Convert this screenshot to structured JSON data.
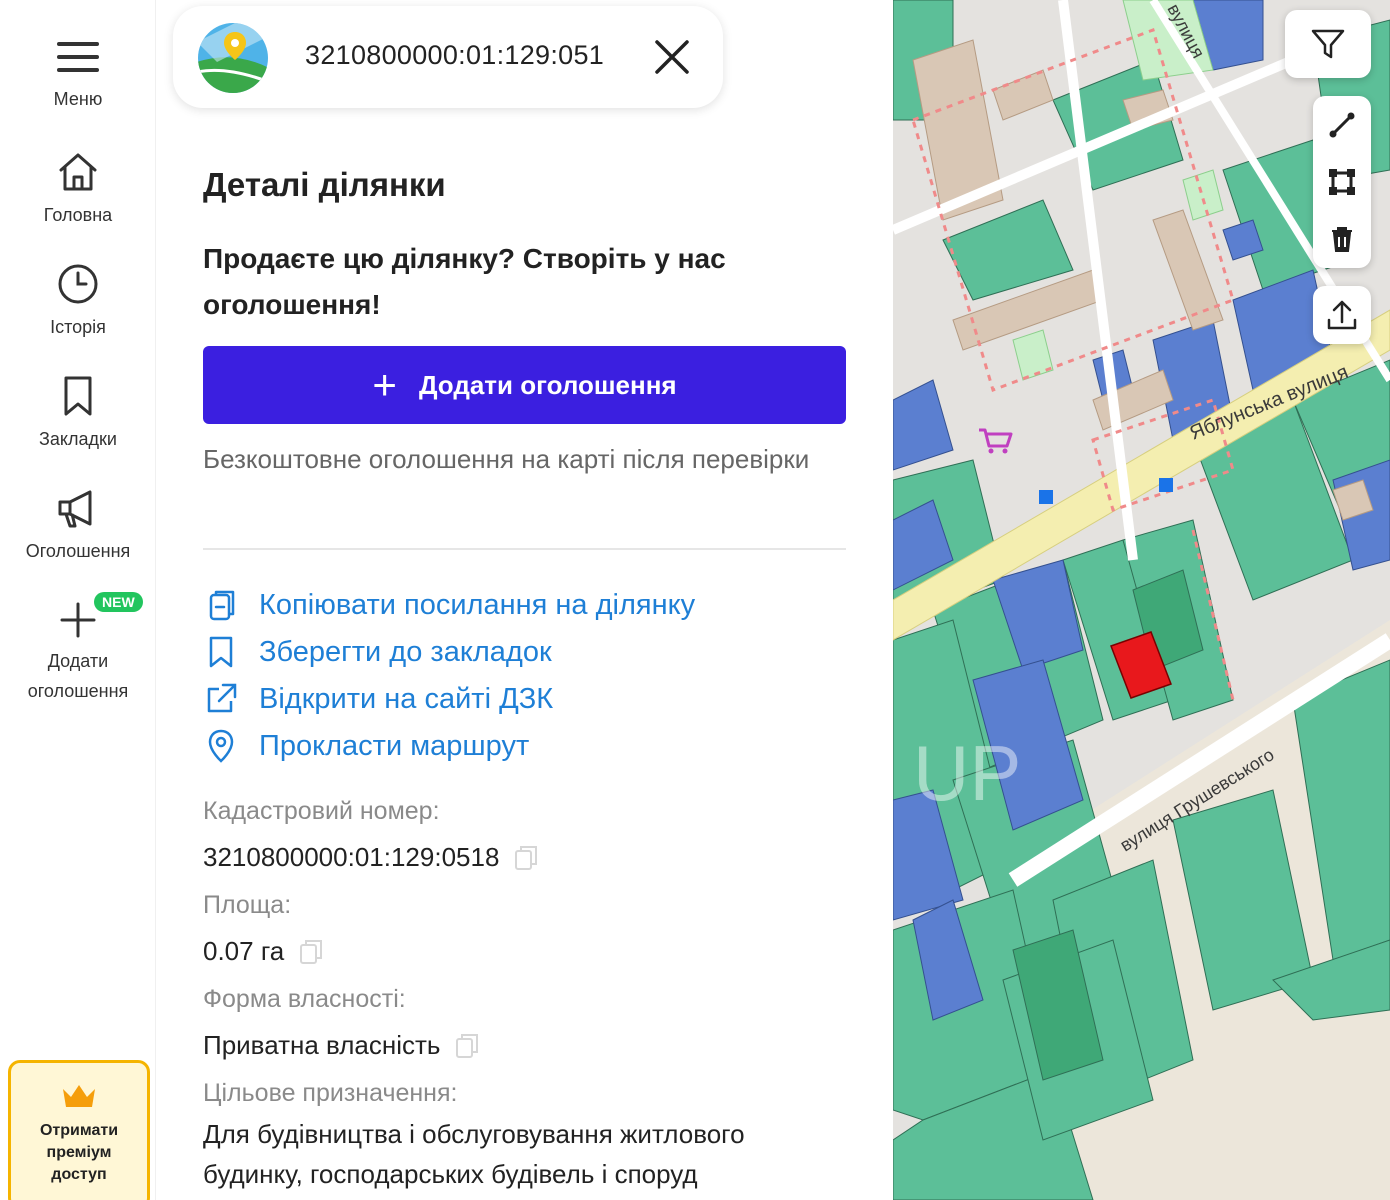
{
  "sidebar": {
    "menu_label": "Меню",
    "items": [
      {
        "label": "Головна"
      },
      {
        "label": "Історія"
      },
      {
        "label": "Закладки"
      },
      {
        "label": "Оголошення"
      },
      {
        "label": "Додати оголошення",
        "badge": "NEW"
      }
    ],
    "premium": {
      "line1": "Отримати",
      "line2": "преміум",
      "line3": "доступ"
    }
  },
  "search": {
    "value": "3210800000:01:129:051"
  },
  "details": {
    "title": "Деталі ділянки",
    "promo": "Продаєте цю ділянку? Створіть у нас оголошення!",
    "add_button_label": "Додати оголошення",
    "free_note": "Безкоштовне оголошення на карті після перевірки",
    "actions": [
      {
        "label": "Копіювати посилання на ділянку",
        "icon": "copy-link-icon"
      },
      {
        "label": "Зберегти до закладок",
        "icon": "bookmark-icon"
      },
      {
        "label": "Відкрити на сайті ДЗК",
        "icon": "external-link-icon"
      },
      {
        "label": "Прокласти маршрут",
        "icon": "location-pin-icon"
      }
    ],
    "fields": {
      "cadastral_label": "Кадастровий номер:",
      "cadastral_value": "3210800000:01:129:0518",
      "area_label": "Площа:",
      "area_value": "0.07 га",
      "ownership_label": "Форма власності:",
      "ownership_value": "Приватна власність",
      "purpose_label": "Цільове призначення:",
      "purpose_value": "Для будівництва і обслуговування житлового будинку, господарських будівель і споруд"
    }
  },
  "map": {
    "street_labels": [
      "Яблунська вулиця",
      "вулиця Грушевського",
      "вулиця"
    ],
    "watermark": "UP",
    "colors": {
      "parcel_green": "#5cbf98",
      "parcel_blue": "#5b7fd0",
      "road": "#f4eeb0",
      "selected_parcel": "#e8181c",
      "accent": "#3b1fe0",
      "link": "#1e7fd6"
    },
    "tools": [
      "filter-icon",
      "measure-line-icon",
      "measure-area-icon",
      "delete-icon",
      "upload-icon"
    ]
  }
}
